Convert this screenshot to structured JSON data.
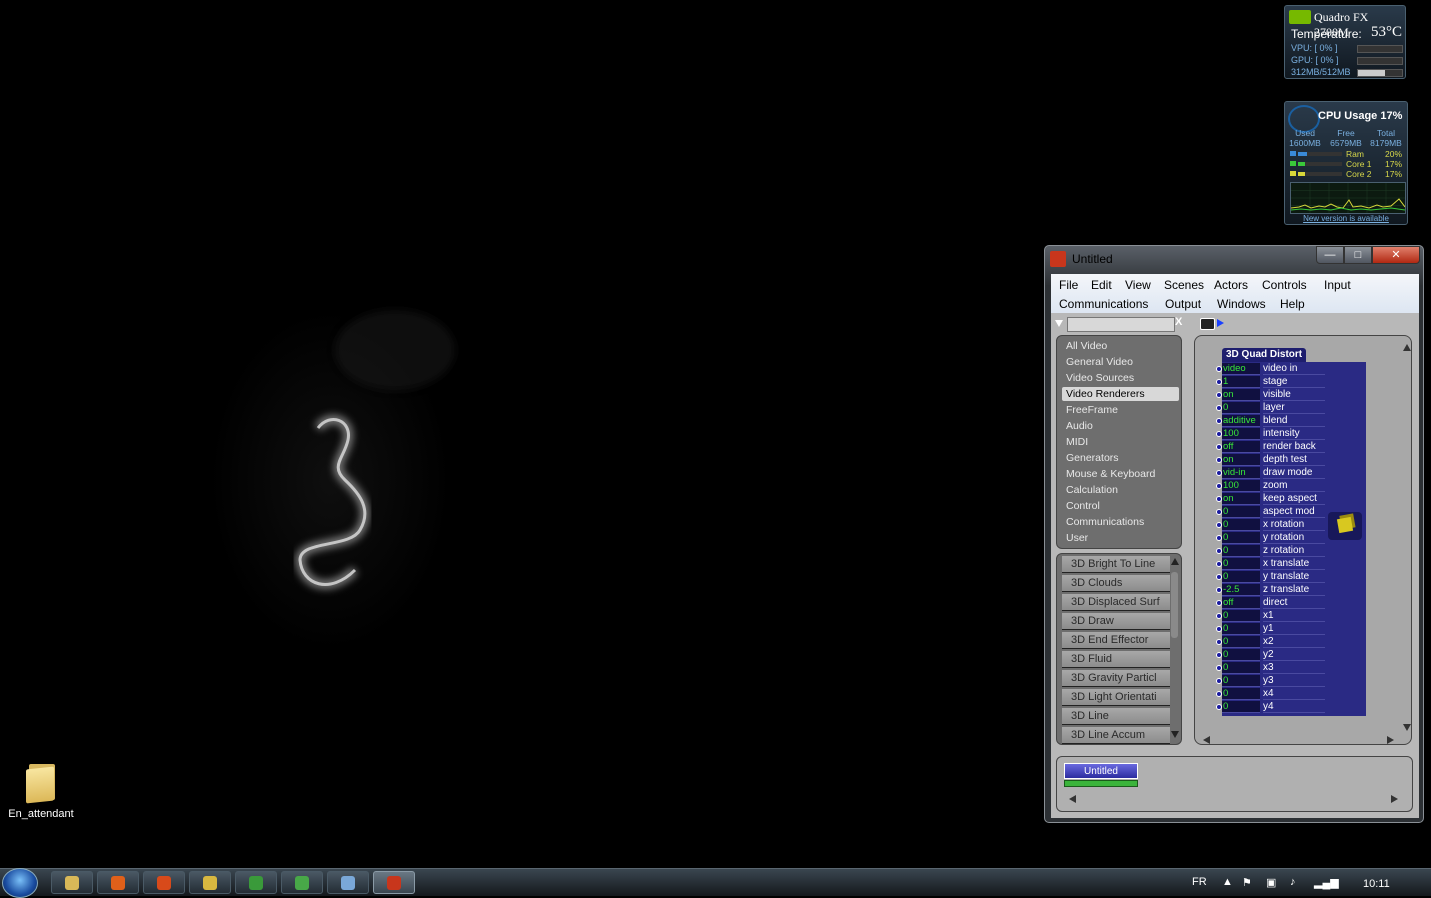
{
  "desktop": {
    "icon_label": "En_attendant"
  },
  "gpu_gadget": {
    "title": "Quadro FX 2700M",
    "temperature_label": "Temperature:",
    "temperature_value": "53°C",
    "vpu": "VPU: [ 0% ]",
    "gpu": "GPU: [ 0% ]",
    "memory": "312MB/512MB",
    "memory_fraction": 0.61
  },
  "cpu_gadget": {
    "title": "CPU Usage",
    "usage": "17%",
    "headers": [
      "Used",
      "Free",
      "Total"
    ],
    "values": [
      "1600MB",
      "6579MB",
      "8179MB"
    ],
    "lines": [
      {
        "name": "Ram",
        "pct": "20%",
        "fraction": 0.2,
        "color": "#3a8ad8"
      },
      {
        "name": "Core 1",
        "pct": "17%",
        "fraction": 0.17,
        "color": "#3ac83a"
      },
      {
        "name": "Core 2",
        "pct": "17%",
        "fraction": 0.17,
        "color": "#d8d83a"
      }
    ],
    "update_text": "New version is available"
  },
  "window": {
    "title": "Untitled",
    "controls": {
      "minimize": "—",
      "maximize": "□",
      "close": "✕"
    },
    "menus": [
      "File",
      "Edit",
      "View",
      "Scenes",
      "Actors",
      "Controls",
      "Input",
      "Communications",
      "Output",
      "Windows",
      "Help"
    ],
    "search_clear": "X",
    "categories": [
      {
        "label": "All Video",
        "selected": false
      },
      {
        "label": "General Video",
        "selected": false
      },
      {
        "label": "Video Sources",
        "selected": false
      },
      {
        "label": "Video Renderers",
        "selected": true
      },
      {
        "label": "FreeFrame",
        "selected": false
      },
      {
        "label": "Audio",
        "selected": false
      },
      {
        "label": "MIDI",
        "selected": false
      },
      {
        "label": "Generators",
        "selected": false
      },
      {
        "label": "Mouse & Keyboard",
        "selected": false
      },
      {
        "label": "Calculation",
        "selected": false
      },
      {
        "label": "Control",
        "selected": false
      },
      {
        "label": "Communications",
        "selected": false
      },
      {
        "label": "User",
        "selected": false
      }
    ],
    "actors": [
      "3D Bright To Line",
      "3D Clouds",
      "3D Displaced Surf",
      "3D Draw",
      "3D End Effector",
      "3D Fluid",
      "3D Gravity Particl",
      "3D Light Orientati",
      "3D Line",
      "3D Line Accum"
    ],
    "actor_box": {
      "title": "3D Quad Distort",
      "rows": [
        {
          "value": "video",
          "name": "video in"
        },
        {
          "value": "1",
          "name": "stage"
        },
        {
          "value": "on",
          "name": "visible"
        },
        {
          "value": "0",
          "name": "layer"
        },
        {
          "value": "additive",
          "name": "blend"
        },
        {
          "value": "100",
          "name": "intensity"
        },
        {
          "value": "off",
          "name": "render back"
        },
        {
          "value": "on",
          "name": "depth test"
        },
        {
          "value": "vid-in",
          "name": "draw mode"
        },
        {
          "value": "100",
          "name": "zoom"
        },
        {
          "value": "on",
          "name": "keep aspect"
        },
        {
          "value": "0",
          "name": "aspect mod"
        },
        {
          "value": "0",
          "name": "x rotation"
        },
        {
          "value": "0",
          "name": "y rotation"
        },
        {
          "value": "0",
          "name": "z rotation"
        },
        {
          "value": "0",
          "name": "x translate"
        },
        {
          "value": "0",
          "name": "y translate"
        },
        {
          "value": "-2.5",
          "name": "z translate"
        },
        {
          "value": "off",
          "name": "direct"
        },
        {
          "value": "0",
          "name": "x1"
        },
        {
          "value": "0",
          "name": "y1"
        },
        {
          "value": "0",
          "name": "x2"
        },
        {
          "value": "0",
          "name": "y2"
        },
        {
          "value": "0",
          "name": "x3"
        },
        {
          "value": "0",
          "name": "y3"
        },
        {
          "value": "0",
          "name": "x4"
        },
        {
          "value": "0",
          "name": "y4"
        }
      ]
    },
    "scene_tab": "Untitled"
  },
  "taskbar": {
    "buttons": [
      {
        "name": "explorer-button",
        "icon": "folder-icon",
        "color": "#d8b858",
        "active": false
      },
      {
        "name": "firefox-button",
        "icon": "firefox-icon",
        "color": "#e0601a",
        "active": false
      },
      {
        "name": "matlab-button",
        "icon": "matlab-icon",
        "color": "#d84a1a",
        "active": false
      },
      {
        "name": "paint-button",
        "icon": "paint-icon",
        "color": "#d8b840",
        "active": false
      },
      {
        "name": "start-app-button",
        "icon": "tree-icon",
        "color": "#3a9a3a",
        "active": false
      },
      {
        "name": "messenger-button",
        "icon": "messenger-icon",
        "color": "#48a848",
        "active": false
      },
      {
        "name": "window-switch-button",
        "icon": "window-icon",
        "color": "#7aa8d8",
        "active": false
      },
      {
        "name": "isadora-button",
        "icon": "isadora-icon",
        "color": "#c8361c",
        "active": true
      }
    ],
    "language": "FR",
    "clock": "10:11"
  }
}
